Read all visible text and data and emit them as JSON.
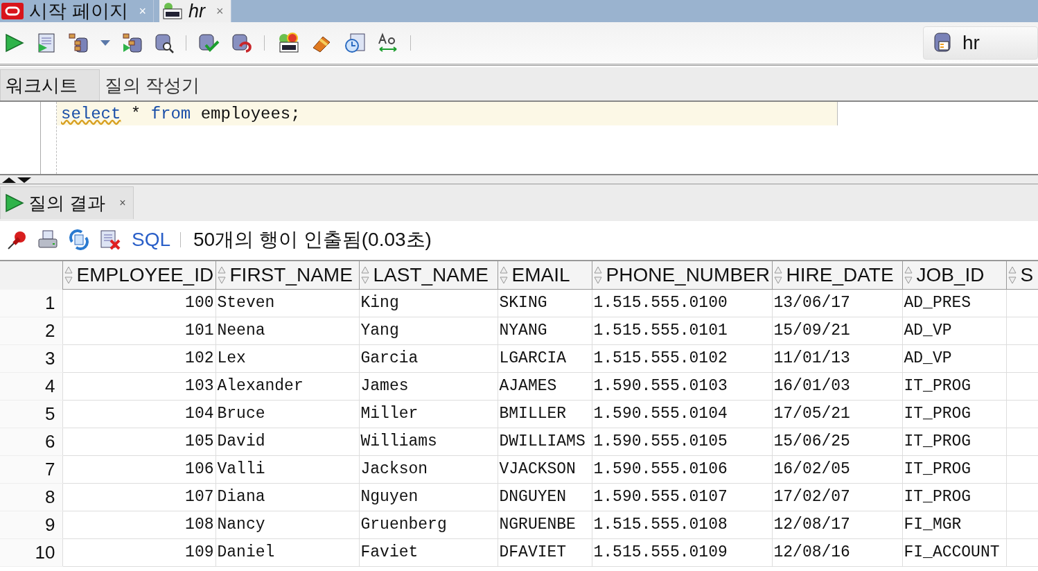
{
  "document_tabs": [
    {
      "label": "시작 페이지",
      "close": "×",
      "kind": "start",
      "selected": false
    },
    {
      "label": "hr",
      "close": "×",
      "kind": "sql",
      "selected": true
    }
  ],
  "connection": {
    "label": "hr"
  },
  "editor_tabs": [
    {
      "label": "워크시트",
      "selected": true
    },
    {
      "label": "질의 작성기",
      "selected": false
    }
  ],
  "editor": {
    "tokens": [
      {
        "text": "select",
        "kind": "keyword"
      },
      {
        "text": " * ",
        "kind": "plain"
      },
      {
        "text": "from",
        "kind": "keyword"
      },
      {
        "text": " employees;",
        "kind": "plain"
      }
    ]
  },
  "results_tab": {
    "label": "질의 결과",
    "close": "×"
  },
  "results_toolbar": {
    "sql_link": "SQL",
    "status": "50개의 행이 인출됨(0.03초)"
  },
  "table": {
    "columns": [
      {
        "label": "EMPLOYEE_ID",
        "kind": "number"
      },
      {
        "label": "FIRST_NAME",
        "kind": "text"
      },
      {
        "label": "LAST_NAME",
        "kind": "text"
      },
      {
        "label": "EMAIL",
        "kind": "text"
      },
      {
        "label": "PHONE_NUMBER",
        "kind": "text"
      },
      {
        "label": "HIRE_DATE",
        "kind": "text"
      },
      {
        "label": "JOB_ID",
        "kind": "text"
      },
      {
        "label": "S",
        "kind": "text"
      }
    ],
    "rows": [
      {
        "num": "1",
        "cells": [
          "100",
          "Steven",
          "King",
          "SKING",
          "1.515.555.0100",
          "13/06/17",
          "AD_PRES"
        ]
      },
      {
        "num": "2",
        "cells": [
          "101",
          "Neena",
          "Yang",
          "NYANG",
          "1.515.555.0101",
          "15/09/21",
          "AD_VP"
        ]
      },
      {
        "num": "3",
        "cells": [
          "102",
          "Lex",
          "Garcia",
          "LGARCIA",
          "1.515.555.0102",
          "11/01/13",
          "AD_VP"
        ]
      },
      {
        "num": "4",
        "cells": [
          "103",
          "Alexander",
          "James",
          "AJAMES",
          "1.590.555.0103",
          "16/01/03",
          "IT_PROG"
        ]
      },
      {
        "num": "5",
        "cells": [
          "104",
          "Bruce",
          "Miller",
          "BMILLER",
          "1.590.555.0104",
          "17/05/21",
          "IT_PROG"
        ]
      },
      {
        "num": "6",
        "cells": [
          "105",
          "David",
          "Williams",
          "DWILLIAMS",
          "1.590.555.0105",
          "15/06/25",
          "IT_PROG"
        ]
      },
      {
        "num": "7",
        "cells": [
          "106",
          "Valli",
          "Jackson",
          "VJACKSON",
          "1.590.555.0106",
          "16/02/05",
          "IT_PROG"
        ]
      },
      {
        "num": "8",
        "cells": [
          "107",
          "Diana",
          "Nguyen",
          "DNGUYEN",
          "1.590.555.0107",
          "17/02/07",
          "IT_PROG"
        ]
      },
      {
        "num": "9",
        "cells": [
          "108",
          "Nancy",
          "Gruenberg",
          "NGRUENBE",
          "1.515.555.0108",
          "12/08/17",
          "FI_MGR"
        ]
      },
      {
        "num": "10",
        "cells": [
          "109",
          "Daniel",
          "Faviet",
          "DFAVIET",
          "1.515.555.0109",
          "12/08/16",
          "FI_ACCOUNT"
        ]
      }
    ]
  }
}
